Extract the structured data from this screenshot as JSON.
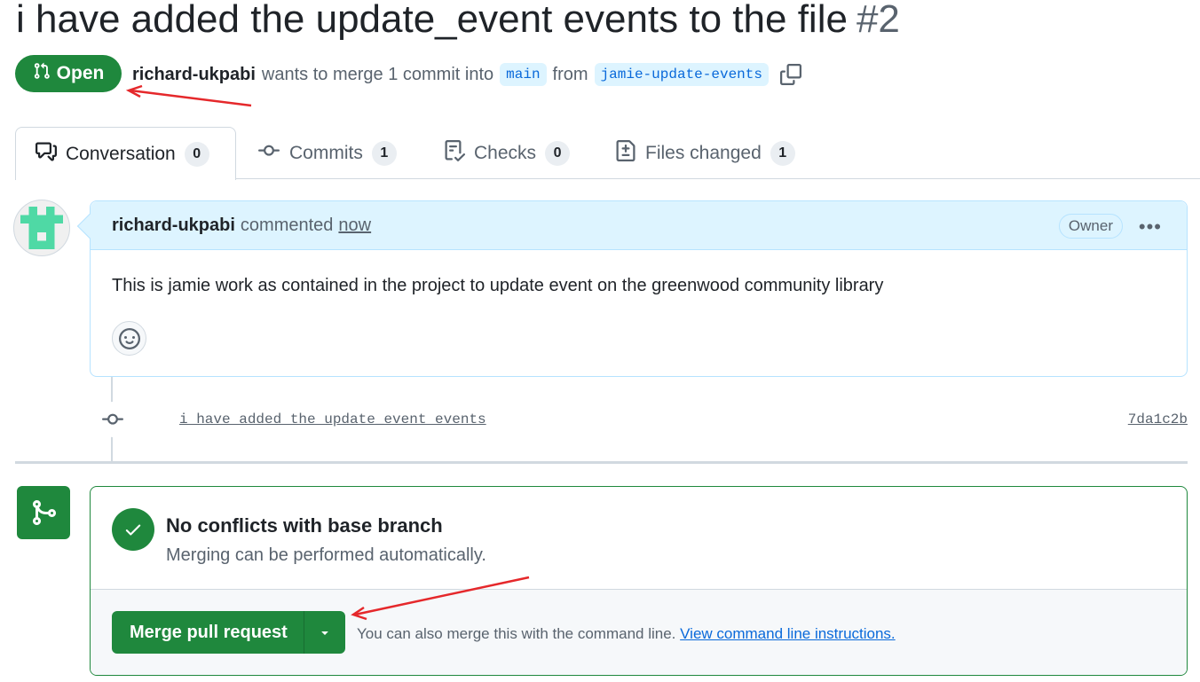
{
  "pr": {
    "title": "i have added the update_event events to the file",
    "number": "#2",
    "state": "Open",
    "author": "richard-ukpabi",
    "merge_text": "wants to merge 1 commit into",
    "base_branch": "main",
    "from_text": "from",
    "head_branch": "jamie-update-events"
  },
  "tabs": [
    {
      "label": "Conversation",
      "count": "0",
      "icon": "comment-discussion-icon"
    },
    {
      "label": "Commits",
      "count": "1",
      "icon": "git-commit-icon"
    },
    {
      "label": "Checks",
      "count": "0",
      "icon": "checklist-icon"
    },
    {
      "label": "Files changed",
      "count": "1",
      "icon": "file-diff-icon"
    }
  ],
  "comment": {
    "author": "richard-ukpabi",
    "action": "commented",
    "time": "now",
    "badge": "Owner",
    "body": "This is jamie work as contained in the project to update event on the greenwood community library"
  },
  "commit": {
    "message": "i have added the update_event events",
    "sha": "7da1c2b"
  },
  "merge": {
    "status_title": "No conflicts with base branch",
    "status_sub": "Merging can be performed automatically.",
    "button_label": "Merge pull request",
    "hint_text": "You can also merge this with the command line.",
    "hint_link": "View command line instructions."
  },
  "colors": {
    "accent_green": "#1f883d",
    "link_blue": "#0969da",
    "annotation_red": "#e5282b"
  }
}
